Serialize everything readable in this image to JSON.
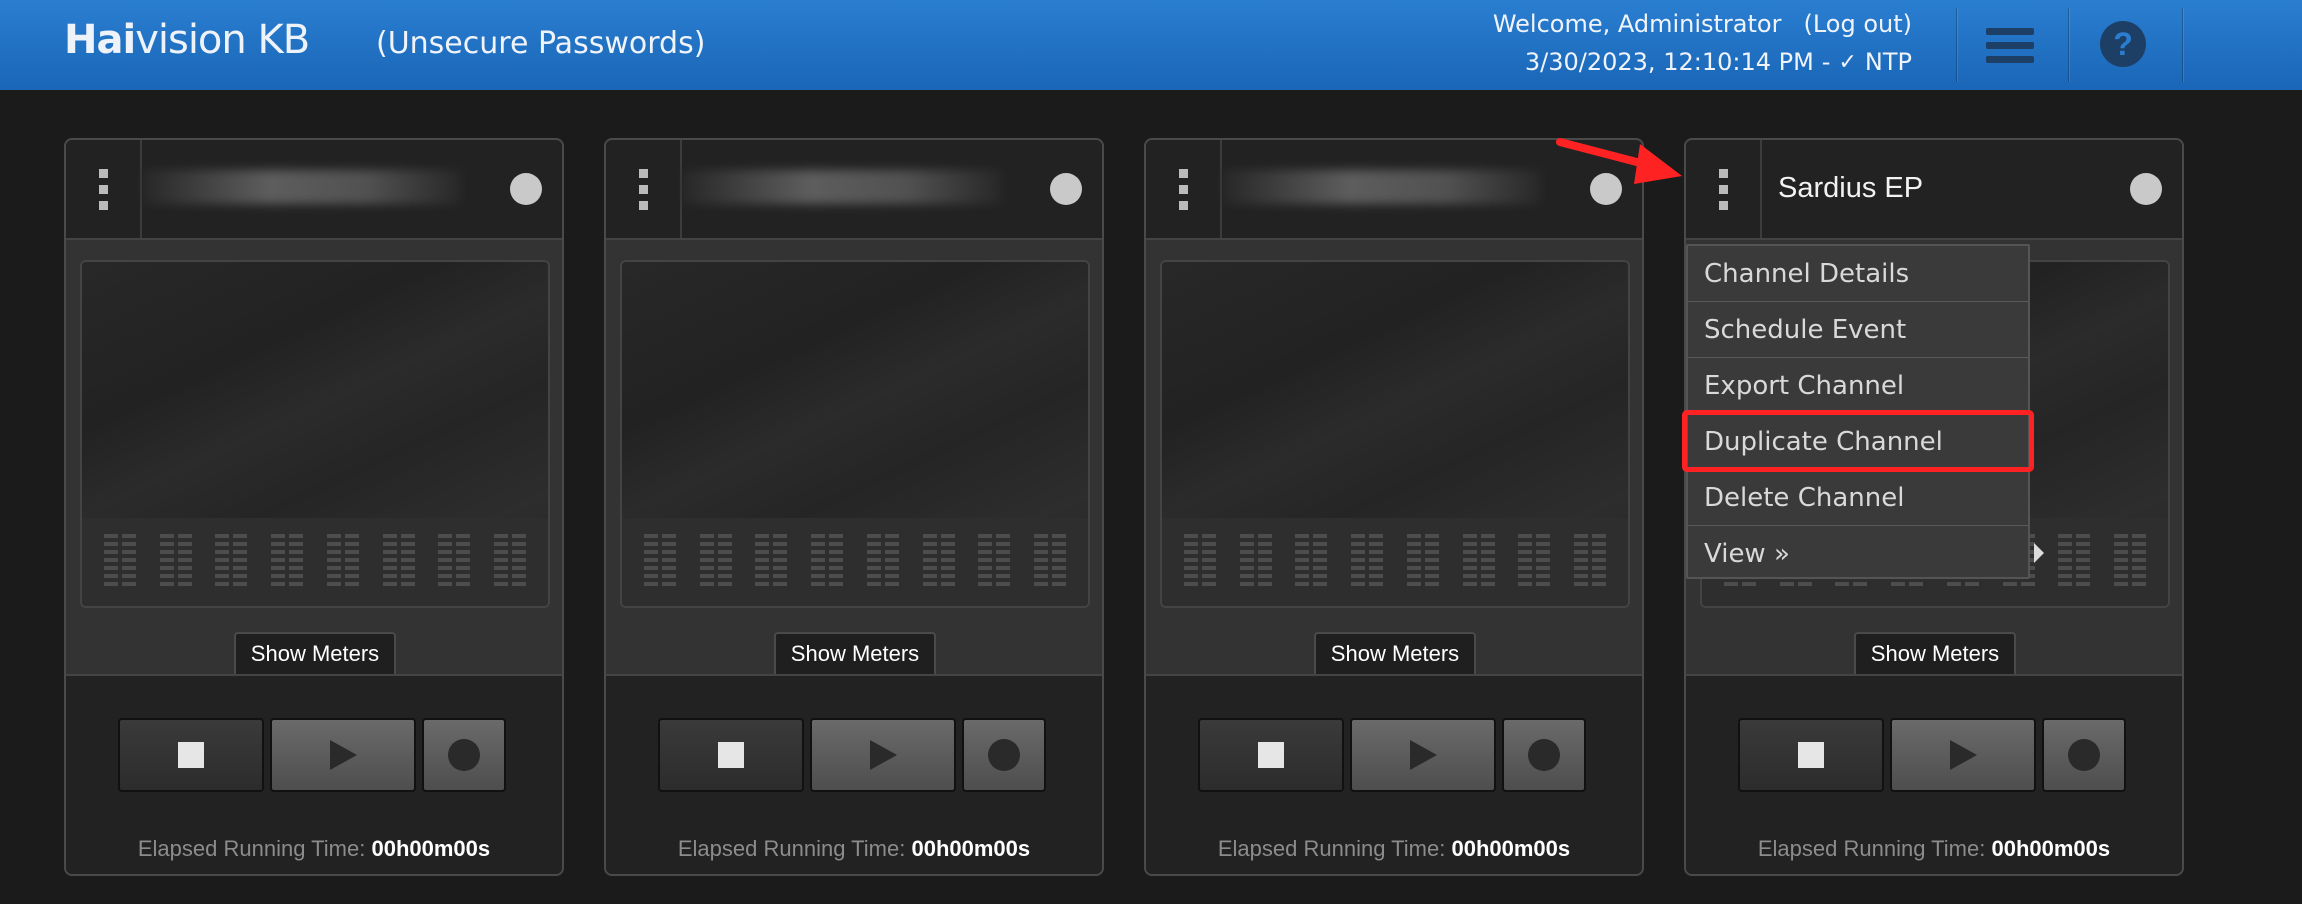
{
  "header": {
    "logo_bold": "Hai",
    "logo_light": "vision KB",
    "subtitle": "(Unsecure Passwords)",
    "welcome": "Welcome, Administrator",
    "logout": "(Log out)",
    "datetime": "3/30/2023, 12:10:14 PM",
    "sep": "-",
    "ntp_icon": "✓",
    "ntp": "NTP",
    "help": "?"
  },
  "channels": [
    {
      "name": "",
      "show_meters": "Show Meters",
      "elapsed_label": "Elapsed Running Time:",
      "elapsed_value": "00h00m00s"
    },
    {
      "name": "",
      "show_meters": "Show Meters",
      "elapsed_label": "Elapsed Running Time:",
      "elapsed_value": "00h00m00s"
    },
    {
      "name": "",
      "show_meters": "Show Meters",
      "elapsed_label": "Elapsed Running Time:",
      "elapsed_value": "00h00m00s"
    },
    {
      "name": "Sardius EP",
      "show_meters": "Show Meters",
      "elapsed_label": "Elapsed Running Time:",
      "elapsed_value": "00h00m00s"
    }
  ],
  "context_menu": {
    "items": [
      "Channel Details",
      "Schedule Event",
      "Export Channel",
      "Duplicate Channel",
      "Delete Channel",
      "View »"
    ],
    "highlighted": "Duplicate Channel"
  },
  "colors": {
    "header_blue": "#1f72c4",
    "background": "#1b1b1b",
    "highlight_red": "#ff2222"
  }
}
